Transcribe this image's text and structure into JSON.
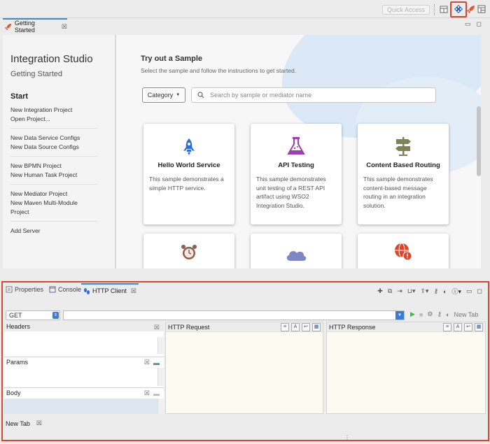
{
  "toolbar": {
    "quick_access": "Quick Access"
  },
  "editor": {
    "tab_label": "Getting Started"
  },
  "getting_started": {
    "title": "Integration Studio",
    "subtitle": "Getting Started",
    "start_heading": "Start",
    "link_groups": [
      [
        "New Integration Project",
        "Open Project..."
      ],
      [
        "New Data Service Configs",
        "New Data Source Configs"
      ],
      [
        "New BPMN Project",
        "New Human Task Project"
      ],
      [
        "New Mediator Project",
        "New Maven Multi-Module Project"
      ],
      [
        "Add Server"
      ]
    ],
    "try_heading": "Try out a Sample",
    "select_text": "Select the sample and follow the instructions to get started.",
    "category_label": "Category",
    "search_placeholder": "Search by sample or mediator name",
    "cards": [
      {
        "title": "Hello World Service",
        "desc": "This sample demonstrates a simple HTTP service.",
        "icon": "rocket-icon"
      },
      {
        "title": "API Testing",
        "desc": "This sample demonstrates unit testing of a REST API artifact using WSO2 Integration Studio.",
        "icon": "flask-icon"
      },
      {
        "title": "Content Based Routing",
        "desc": "This sample demonstrates content-based message routing in an integration solution.",
        "icon": "signpost-icon"
      }
    ],
    "lower_cards": [
      {
        "icon": "alarm-clock-icon"
      },
      {
        "icon": "cloud-icon"
      },
      {
        "icon": "globe-error-icon"
      }
    ]
  },
  "bottom_panel": {
    "tabs": [
      {
        "label": "Properties",
        "icon": "properties-icon"
      },
      {
        "label": "Console",
        "icon": "console-icon"
      },
      {
        "label": "HTTP Client",
        "icon": "footprints-icon"
      }
    ],
    "method": "GET",
    "url_value": "",
    "new_tab_action": "New Tab",
    "headers_label": "Headers",
    "params_label": "Params",
    "body_label": "Body",
    "request_label": "HTTP Request",
    "response_label": "HTTP Response",
    "bottom_tab_label": "New Tab"
  },
  "colors": {
    "highlight": "#e0442b",
    "accent": "#3b8ed6",
    "rocket": "#2f6fd0",
    "flask": "#9c3fb1",
    "signpost": "#7d8352"
  }
}
